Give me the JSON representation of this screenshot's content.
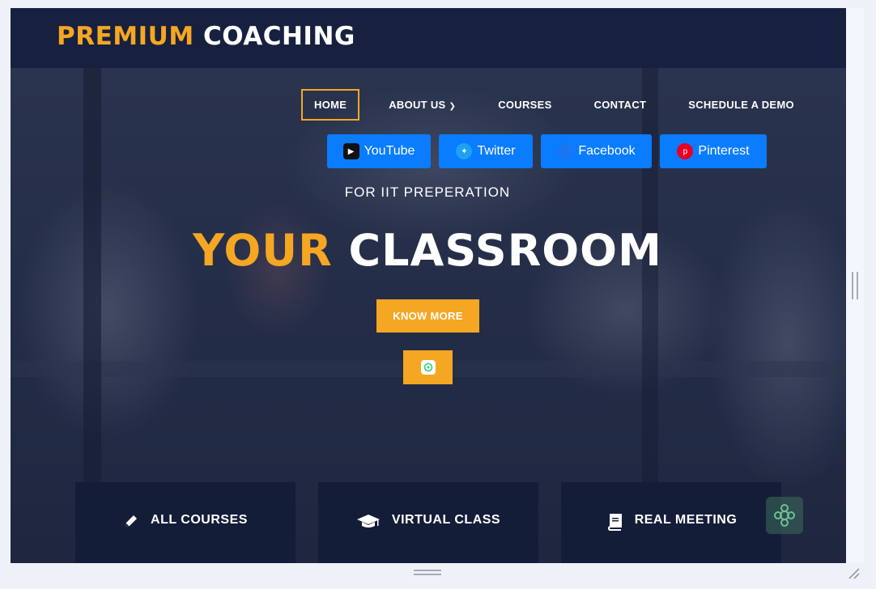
{
  "logo": {
    "accent": "PREMIUM",
    "rest": "COACHING"
  },
  "nav": {
    "items": [
      {
        "label": "HOME",
        "active": true
      },
      {
        "label": "ABOUT US",
        "dropdown": true
      },
      {
        "label": "COURSES"
      },
      {
        "label": "CONTACT"
      },
      {
        "label": "SCHEDULE A DEMO"
      }
    ]
  },
  "socials": [
    {
      "label": "YouTube",
      "icon": "youtube-icon"
    },
    {
      "label": "Twitter",
      "icon": "twitter-icon"
    },
    {
      "label": "Facebook",
      "icon": "facebook-icon"
    },
    {
      "label": "Pinterest",
      "icon": "pinterest-icon"
    }
  ],
  "hero": {
    "kicker": "FOR IIT PREPERATION",
    "headline_accent": "YOUR",
    "headline_rest": "CLASSROOM",
    "cta_label": "KNOW MORE",
    "whatsapp_icon": "whatsapp-icon"
  },
  "cards": [
    {
      "label": "ALL COURSES",
      "icon": "pencil-icon"
    },
    {
      "label": "VIRTUAL CLASS",
      "icon": "graduation-cap-icon"
    },
    {
      "label": "REAL MEETING",
      "icon": "book-icon"
    }
  ],
  "colors": {
    "accent": "#f5a623",
    "header_bg": "#17213f",
    "card_bg": "#141d38",
    "social_btn": "#0a7cff"
  }
}
